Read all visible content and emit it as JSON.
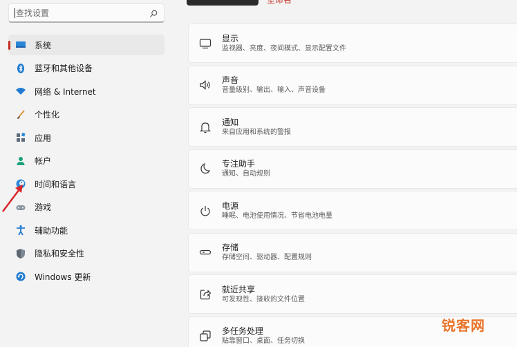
{
  "search": {
    "placeholder": "查找设置"
  },
  "header": {
    "account_name": "室命名"
  },
  "nav": {
    "items": [
      {
        "label": "系统",
        "icon": "monitor-icon",
        "active": true
      },
      {
        "label": "蓝牙和其他设备",
        "icon": "bluetooth-icon"
      },
      {
        "label": "网络 & Internet",
        "icon": "wifi-icon"
      },
      {
        "label": "个性化",
        "icon": "brush-icon"
      },
      {
        "label": "应用",
        "icon": "apps-icon"
      },
      {
        "label": "帐户",
        "icon": "person-icon"
      },
      {
        "label": "时间和语言",
        "icon": "globe-clock-icon"
      },
      {
        "label": "游戏",
        "icon": "gamepad-icon"
      },
      {
        "label": "辅助功能",
        "icon": "accessibility-icon"
      },
      {
        "label": "隐私和安全性",
        "icon": "shield-icon"
      },
      {
        "label": "Windows 更新",
        "icon": "update-icon"
      }
    ]
  },
  "cards": [
    {
      "title": "显示",
      "desc": "监视器、亮度、夜间模式、显示配置文件",
      "icon": "display-icon"
    },
    {
      "title": "声音",
      "desc": "音量级别、输出、输入、声音设备",
      "icon": "speaker-icon"
    },
    {
      "title": "通知",
      "desc": "来自应用和系统的警报",
      "icon": "bell-icon"
    },
    {
      "title": "专注助手",
      "desc": "通知、自动规则",
      "icon": "moon-icon"
    },
    {
      "title": "电源",
      "desc": "睡眠、电池使用情况、节省电池电量",
      "icon": "power-icon"
    },
    {
      "title": "存储",
      "desc": "存储空间、驱动器、配置规则",
      "icon": "storage-icon"
    },
    {
      "title": "就近共享",
      "desc": "可发现性、接收的文件位置",
      "icon": "share-icon"
    },
    {
      "title": "多任务处理",
      "desc": "贴靠窗口、桌面、任务切换",
      "icon": "multitask-icon"
    }
  ],
  "watermark": "锐客网",
  "colors": {
    "accent": "#c42b1c",
    "arrow": "#d9262b"
  }
}
